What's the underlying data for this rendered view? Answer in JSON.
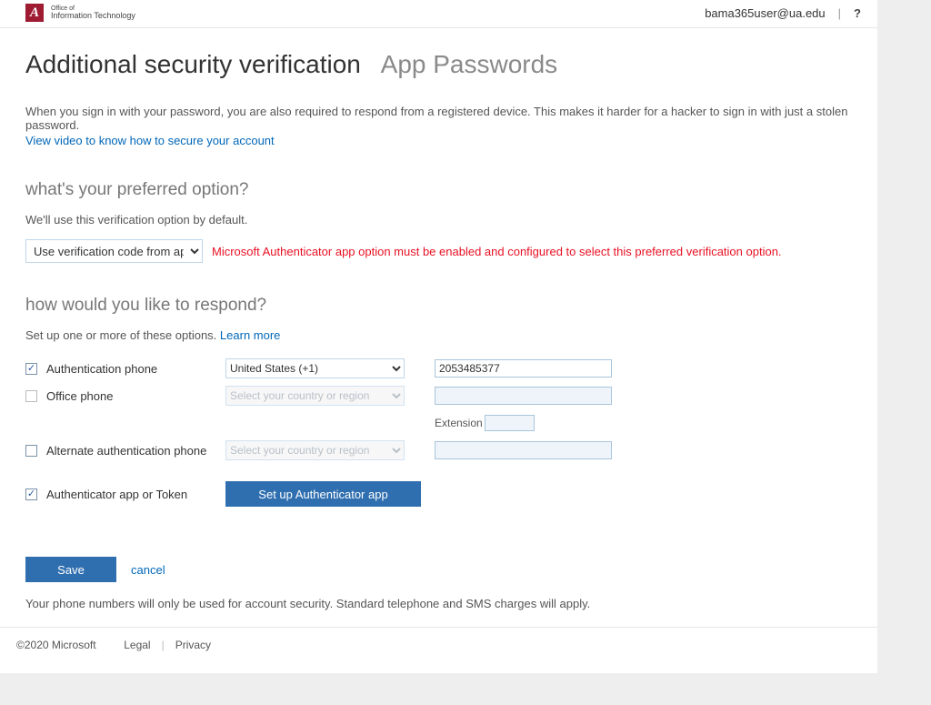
{
  "topbar": {
    "brand_line1": "Office of",
    "brand_line2": "Information Technology",
    "brand_logo_letter": "A",
    "user_email": "bama365user@ua.edu",
    "help_symbol": "?"
  },
  "title": {
    "main": "Additional security verification",
    "sub": "App Passwords"
  },
  "intro": {
    "text": "When you sign in with your password, you are also required to respond from a registered device. This makes it harder for a hacker to sign in with just a stolen password.",
    "link": "View video to know how to secure your account"
  },
  "preferred": {
    "heading": "what's your preferred option?",
    "desc": "We'll use this verification option by default.",
    "selected": "Use verification code from app or token",
    "error": "Microsoft Authenticator app option must be enabled and configured to select this preferred verification option."
  },
  "respond": {
    "heading": "how would you like to respond?",
    "desc_prefix": "Set up one or more of these options. ",
    "learn_more": "Learn more",
    "auth_phone_label": "Authentication phone",
    "auth_phone_country": "United States (+1)",
    "auth_phone_number": "2053485377",
    "office_phone_label": "Office phone",
    "country_placeholder": "Select your country or region",
    "extension_label": "Extension",
    "alt_phone_label": "Alternate authentication phone",
    "app_token_label": "Authenticator app or Token",
    "setup_app_btn": "Set up Authenticator app"
  },
  "actions": {
    "save": "Save",
    "cancel": "cancel"
  },
  "footnote": "Your phone numbers will only be used for account security. Standard telephone and SMS charges will apply.",
  "footer": {
    "copyright": "©2020 Microsoft",
    "legal": "Legal",
    "privacy": "Privacy"
  }
}
